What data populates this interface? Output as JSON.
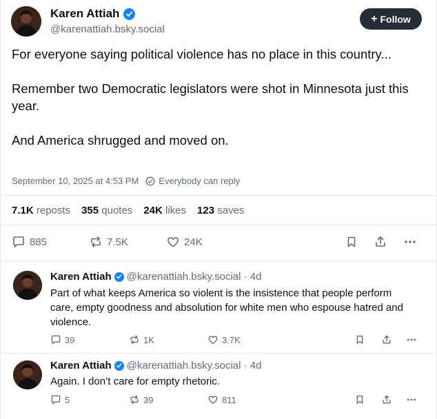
{
  "post": {
    "author_name": "Karen Attiah",
    "author_handle": "@karenattiah.bsky.social",
    "follow_label": "Follow",
    "paragraphs": [
      "For everyone saying political violence has no place in this country...",
      "Remember two Democratic legislators were shot in Minnesota just this year.",
      "And America shrugged and moved on."
    ],
    "timestamp": "September 10, 2025 at 4:53 PM",
    "reply_setting": "Everybody can reply",
    "stats": {
      "reposts_count": "7.1K",
      "reposts_label": "reposts",
      "quotes_count": "355",
      "quotes_label": "quotes",
      "likes_count": "24K",
      "likes_label": "likes",
      "saves_count": "123",
      "saves_label": "saves"
    },
    "actions": {
      "replies": "885",
      "reposts": "7.5K",
      "likes": "24K"
    }
  },
  "replies": [
    {
      "author_name": "Karen Attiah",
      "handle_age": "@karenattiah.bsky.social · 4d",
      "text": "Part of what keeps America so violent is the insistence that people perform care, empty goodness and absolution for white men who espouse hatred and  violence.",
      "replies": "39",
      "reposts": "1K",
      "likes": "3.7K"
    },
    {
      "author_name": "Karen Attiah",
      "handle_age": "@karenattiah.bsky.social · 4d",
      "text": "Again. I don’t care for empty rhetoric.",
      "replies": "5",
      "reposts": "39",
      "likes": "811"
    }
  ],
  "colors": {
    "accent_verified": "#1083fe",
    "follow_bg": "#252d38",
    "muted_text": "#5f6b7a",
    "divider": "#e5e8eb"
  },
  "icons": [
    "verified-badge-icon",
    "globe-icon",
    "reply-icon",
    "repost-icon",
    "like-icon",
    "bookmark-icon",
    "share-icon",
    "more-icon"
  ]
}
